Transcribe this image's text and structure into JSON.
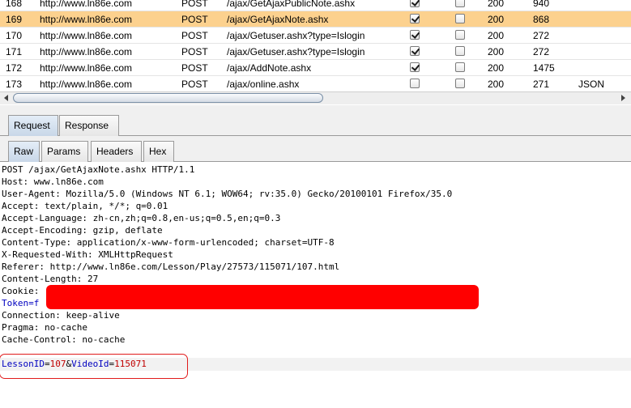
{
  "history": {
    "rows": [
      {
        "num": "168",
        "host": "http://www.ln86e.com",
        "method": "POST",
        "url": "/ajax/GetAjaxPublicNote.ashx",
        "edited": true,
        "comment": false,
        "status": "200",
        "length": "940",
        "mime": "",
        "selected": false
      },
      {
        "num": "169",
        "host": "http://www.ln86e.com",
        "method": "POST",
        "url": "/ajax/GetAjaxNote.ashx",
        "edited": true,
        "comment": false,
        "status": "200",
        "length": "868",
        "mime": "",
        "selected": true
      },
      {
        "num": "170",
        "host": "http://www.ln86e.com",
        "method": "POST",
        "url": "/ajax/Getuser.ashx?type=Islogin",
        "edited": true,
        "comment": false,
        "status": "200",
        "length": "272",
        "mime": "",
        "selected": false
      },
      {
        "num": "171",
        "host": "http://www.ln86e.com",
        "method": "POST",
        "url": "/ajax/Getuser.ashx?type=Islogin",
        "edited": true,
        "comment": false,
        "status": "200",
        "length": "272",
        "mime": "",
        "selected": false
      },
      {
        "num": "172",
        "host": "http://www.ln86e.com",
        "method": "POST",
        "url": "/ajax/AddNote.ashx",
        "edited": true,
        "comment": false,
        "status": "200",
        "length": "1475",
        "mime": "",
        "selected": false
      },
      {
        "num": "173",
        "host": "http://www.ln86e.com",
        "method": "POST",
        "url": "/ajax/online.ashx",
        "edited": false,
        "comment": false,
        "status": "200",
        "length": "271",
        "mime": "JSON",
        "selected": false
      }
    ]
  },
  "tabs": {
    "request": "Request",
    "response": "Response"
  },
  "subtabs": {
    "raw": "Raw",
    "params": "Params",
    "headers": "Headers",
    "hex": "Hex"
  },
  "request": {
    "lines": [
      "POST /ajax/GetAjaxNote.ashx HTTP/1.1",
      "Host: www.ln86e.com",
      "User-Agent: Mozilla/5.0 (Windows NT 6.1; WOW64; rv:35.0) Gecko/20100101 Firefox/35.0",
      "Accept: text/plain, */*; q=0.01",
      "Accept-Language: zh-cn,zh;q=0.8,en-us;q=0.5,en;q=0.3",
      "Accept-Encoding: gzip, deflate",
      "Content-Type: application/x-www-form-urlencoded; charset=UTF-8",
      "X-Requested-With: XMLHttpRequest",
      "Referer: http://www.ln86e.com/Lesson/Play/27573/115071/107.html",
      "Content-Length: 27",
      "Cookie: ",
      "Token=f",
      "Connection: keep-alive",
      "Pragma: no-cache",
      "Cache-Control: no-cache"
    ],
    "body": {
      "k1": "LessonID",
      "v1": "107",
      "k2": "VideoId",
      "v2": "115071"
    }
  },
  "colors": {
    "selected_row": "#fcd18e",
    "param_name": "#0000c0",
    "param_value": "#c00000",
    "redaction": "#ff0000"
  }
}
